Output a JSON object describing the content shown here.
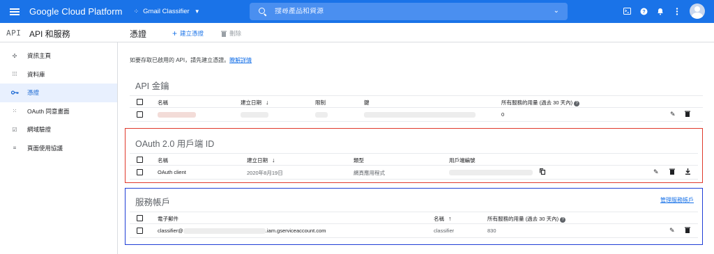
{
  "topbar": {
    "brand": "Google Cloud Platform",
    "project": "Gmail Classifier",
    "search_placeholder": "搜尋產品和資源"
  },
  "header": {
    "section_title": "API 和服務",
    "page_title": "憑證",
    "create_label": "建立憑證",
    "delete_label": "刪除"
  },
  "sidebar": {
    "items": [
      {
        "label": "資訊主頁",
        "icon": "dashboard-icon"
      },
      {
        "label": "資料庫",
        "icon": "library-icon"
      },
      {
        "label": "憑證",
        "icon": "key-icon",
        "active": true
      },
      {
        "label": "OAuth 同意畫面",
        "icon": "consent-icon"
      },
      {
        "label": "網域驗證",
        "icon": "domain-icon"
      },
      {
        "label": "頁面使用協議",
        "icon": "agreement-icon"
      }
    ]
  },
  "notice": {
    "text": "如要存取已啟用的 API，請先建立憑證。",
    "link": "瞭解詳情"
  },
  "api_keys": {
    "title": "API 金鑰",
    "columns": [
      "名稱",
      "建立日期",
      "限制",
      "鍵",
      "所有服務的用量 (過去 30 天內)"
    ],
    "row": {
      "usage": "0"
    }
  },
  "oauth": {
    "title": "OAuth 2.0 用戶端 ID",
    "columns": [
      "名稱",
      "建立日期",
      "類型",
      "用戶端編號"
    ],
    "row": {
      "name": "OAuth client",
      "date": "2020年8月19日",
      "type": "網頁應用程式"
    }
  },
  "service_accounts": {
    "title": "服務帳戶",
    "manage_link": "管理服務帳戶",
    "columns": [
      "電子郵件",
      "名稱",
      "所有服務的用量 (過去 30 天內)"
    ],
    "row": {
      "email_prefix": "classifier@",
      "email_suffix": ".iam.gserviceaccount.com",
      "name": "classifier",
      "usage": "830"
    }
  },
  "colors": {
    "accent": "#1a73e8",
    "highlight_red": "#e0392b",
    "highlight_blue": "#1f3ed6"
  }
}
